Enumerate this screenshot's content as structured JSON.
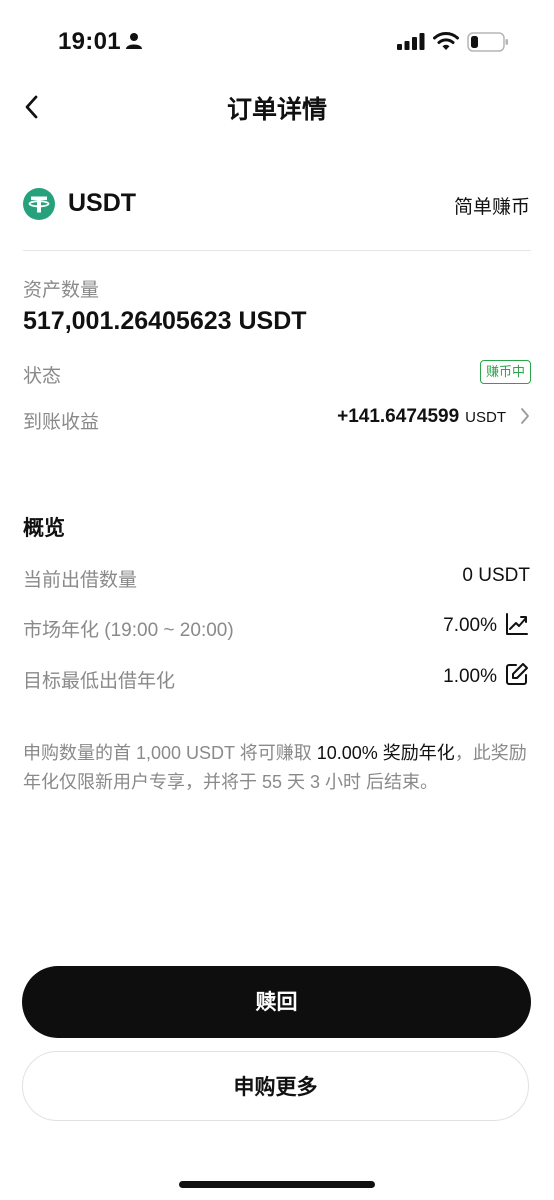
{
  "status_bar": {
    "time": "19:01",
    "icons": [
      "person-icon",
      "signal-icon",
      "wifi-icon",
      "battery-icon"
    ]
  },
  "header": {
    "back_icon": "chevron-left-icon",
    "title": "订单详情"
  },
  "asset": {
    "coin_icon": "tether-icon",
    "coin_name": "USDT",
    "product_type": "简单赚币",
    "brand_color": "#26a17b"
  },
  "details": {
    "amount_label": "资产数量",
    "amount_value": "517,001.26405623 USDT",
    "status_label": "状态",
    "status_badge": "赚币中",
    "status_color": "#2aa54a",
    "income_label": "到账收益",
    "income_value": "+141.6474599",
    "income_unit": "USDT"
  },
  "overview": {
    "title": "概览",
    "rows": [
      {
        "label": "当前出借数量",
        "value": "0 USDT"
      },
      {
        "label": "市场年化 (19:00 ~ 20:00)",
        "value": "7.00%",
        "icon": "trend-chart-icon"
      },
      {
        "label": "目标最低出借年化",
        "value": "1.00%",
        "icon": "edit-icon"
      }
    ]
  },
  "note": {
    "part1": "申购数量的首 1,000 USDT 将可赚取 ",
    "highlight": "10.00% 奖励年化",
    "part2": "，此奖励年化仅限新用户专享，并将于 55 天 3 小时 后结束。"
  },
  "actions": {
    "redeem_label": "赎回",
    "subscribe_more_label": "申购更多"
  }
}
